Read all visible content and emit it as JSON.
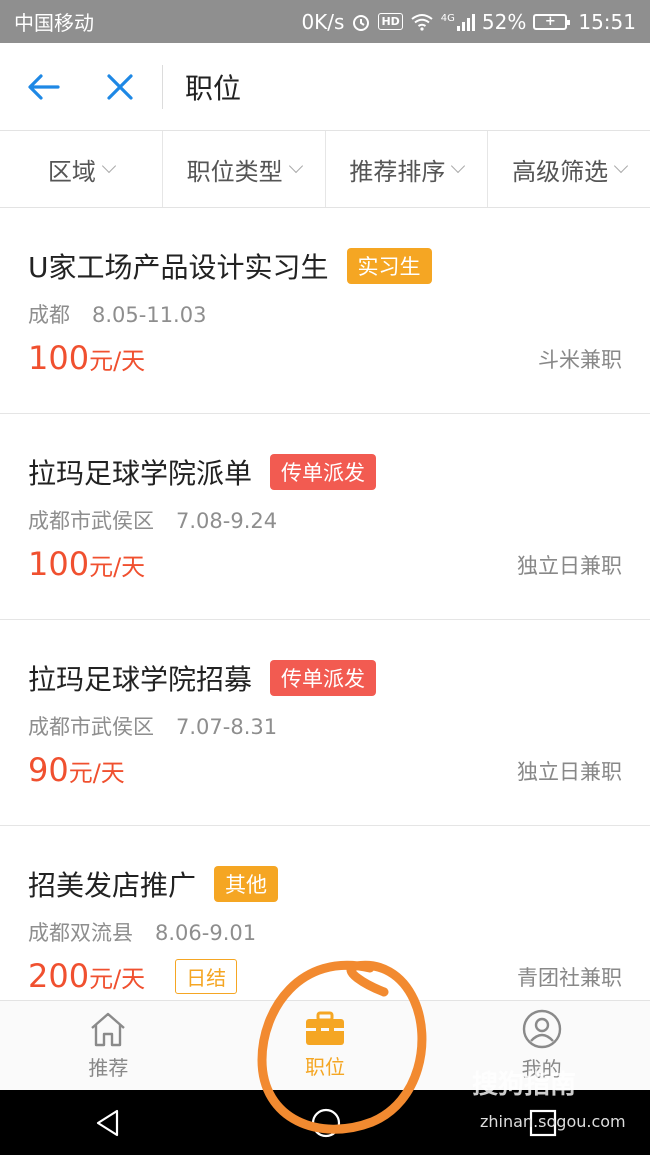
{
  "status_bar": {
    "carrier": "中国移动",
    "speed": "0K/s",
    "hd": "HD",
    "network": "4G",
    "battery": "52%",
    "time": "15:51"
  },
  "header": {
    "title": "职位",
    "icons": [
      "back-arrow-icon",
      "close-icon"
    ]
  },
  "filters": [
    {
      "label": "区域"
    },
    {
      "label": "职位类型"
    },
    {
      "label": "推荐排序"
    },
    {
      "label": "高级筛选"
    }
  ],
  "jobs": [
    {
      "title": "U家工场产品设计实习生",
      "tag": "实习生",
      "tag_color": "#f5a623",
      "location": "成都",
      "dates": "8.05-11.03",
      "amount": "100",
      "unit": "元/天",
      "company": "斗米兼职",
      "settle": ""
    },
    {
      "title": "拉玛足球学院派单",
      "tag": "传单派发",
      "tag_color": "#f25b51",
      "location": "成都市武侯区",
      "dates": "7.08-9.24",
      "amount": "100",
      "unit": "元/天",
      "company": "独立日兼职",
      "settle": ""
    },
    {
      "title": "拉玛足球学院招募",
      "tag": "传单派发",
      "tag_color": "#f25b51",
      "location": "成都市武侯区",
      "dates": "7.07-8.31",
      "amount": "90",
      "unit": "元/天",
      "company": "独立日兼职",
      "settle": ""
    },
    {
      "title": "招美发店推广",
      "tag": "其他",
      "tag_color": "#f5a623",
      "location": "成都双流县",
      "dates": "8.06-9.01",
      "amount": "200",
      "unit": "元/天",
      "company": "青团社兼职",
      "settle": "日结"
    }
  ],
  "tabbar": {
    "tabs": [
      {
        "label": "推荐",
        "icon": "home-icon"
      },
      {
        "label": "职位",
        "icon": "briefcase-icon",
        "active": true
      },
      {
        "label": "我的",
        "icon": "profile-icon"
      }
    ],
    "active_color": "#f5a623"
  },
  "watermark": {
    "text": "搜狗指南",
    "url": "zhinan.sogou.com"
  },
  "colors": {
    "accent": "#1e88e5",
    "price": "#f0502f",
    "annotation": "#f28a30"
  }
}
